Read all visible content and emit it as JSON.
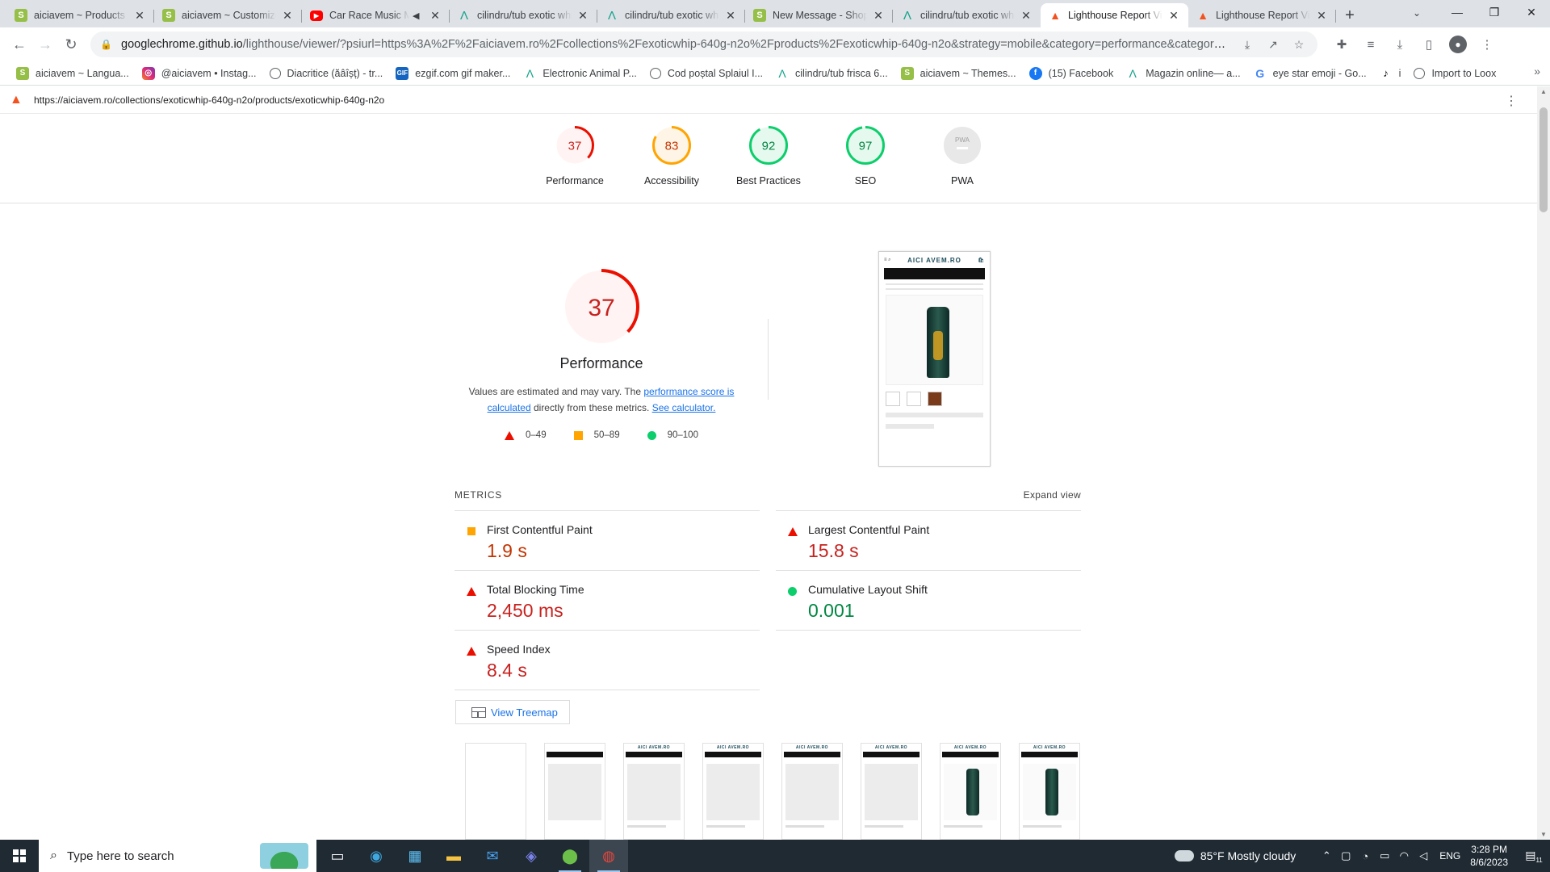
{
  "browser": {
    "tabs": [
      {
        "title": "aiciavem ~ Products ~ c",
        "icon": "shopify-icon",
        "active": false
      },
      {
        "title": "aiciavem ~ Customize C",
        "icon": "shopify-icon",
        "active": false
      },
      {
        "title": "Car Race Music Mi",
        "icon": "youtube-icon",
        "active": false,
        "audio": true
      },
      {
        "title": "cilindru/tub exotic whi",
        "icon": "aa-icon",
        "active": false
      },
      {
        "title": "cilindru/tub exotic whi",
        "icon": "aa-icon",
        "active": false
      },
      {
        "title": "New Message - Shopi",
        "icon": "shopify-icon",
        "active": false
      },
      {
        "title": "cilindru/tub exotic whi",
        "icon": "aa-icon",
        "active": false
      },
      {
        "title": "Lighthouse Report Vie",
        "icon": "lighthouse-icon",
        "active": true
      },
      {
        "title": "Lighthouse Report Vie",
        "icon": "lighthouse-icon",
        "active": false
      }
    ],
    "address": {
      "host": "googlechrome.github.io",
      "rest": "/lighthouse/viewer/?psiurl=https%3A%2F%2Faiciavem.ro%2Fcollections%2Fexoticwhip-640g-n2o%2Fproducts%2Fexoticwhip-640g-n2o&strategy=mobile&category=performance&category=accessibility&categor..."
    },
    "bookmarks": [
      {
        "label": "aiciavem ~ Langua...",
        "icon": "shop"
      },
      {
        "label": "@aiciavem • Instag...",
        "icon": "ig"
      },
      {
        "label": "Diacritice (ăâîșț) - tr...",
        "icon": "globe"
      },
      {
        "label": "ezgif.com gif maker...",
        "icon": "gif"
      },
      {
        "label": "Electronic Animal P...",
        "icon": "aa"
      },
      {
        "label": "Cod poștal Splaiul I...",
        "icon": "globe"
      },
      {
        "label": "cilindru/tub frisca 6...",
        "icon": "aa"
      },
      {
        "label": "aiciavem ~ Themes...",
        "icon": "shop"
      },
      {
        "label": "(15) Facebook",
        "icon": "fb"
      },
      {
        "label": "Magazin online— a...",
        "icon": "aa"
      },
      {
        "label": "eye star emoji - Go...",
        "icon": "g"
      },
      {
        "label": "i",
        "icon": "tt"
      },
      {
        "label": "Import to Loox",
        "icon": "globe"
      }
    ]
  },
  "lighthouse": {
    "report_url": "https://aiciavem.ro/collections/exoticwhip-640g-n2o/products/exoticwhip-640g-n2o",
    "gauges": [
      {
        "label": "Performance",
        "score": "37",
        "value": 37,
        "rating": "fail"
      },
      {
        "label": "Accessibility",
        "score": "83",
        "value": 83,
        "rating": "average"
      },
      {
        "label": "Best Practices",
        "score": "92",
        "value": 92,
        "rating": "pass"
      },
      {
        "label": "SEO",
        "score": "97",
        "value": 97,
        "rating": "pass"
      },
      {
        "label": "PWA",
        "score": "",
        "value": 0,
        "rating": "pwa",
        "badge": "PWA"
      }
    ],
    "perf": {
      "score": "37",
      "value": 37,
      "title": "Performance",
      "desc_before": "Values are estimated and may vary. The ",
      "desc_link1": "performance score is calculated",
      "desc_middle": " directly from these metrics. ",
      "desc_link2": "See calculator."
    },
    "legend": [
      {
        "shape": "triangle",
        "label": "0–49"
      },
      {
        "shape": "square",
        "label": "50–89"
      },
      {
        "shape": "circle",
        "label": "90–100"
      }
    ],
    "final_screenshot": {
      "brand": "AICI AVEM.RO"
    },
    "metrics_title": "METRICS",
    "expand_label": "Expand view",
    "metrics": [
      {
        "name": "First Contentful Paint",
        "value": "1.9 s",
        "rating": "average"
      },
      {
        "name": "Largest Contentful Paint",
        "value": "15.8 s",
        "rating": "fail"
      },
      {
        "name": "Total Blocking Time",
        "value": "2,450 ms",
        "rating": "fail"
      },
      {
        "name": "Cumulative Layout Shift",
        "value": "0.001",
        "rating": "pass"
      },
      {
        "name": "Speed Index",
        "value": "8.4 s",
        "rating": "fail"
      }
    ],
    "treemap_label": "View Treemap",
    "filmstrip_brand": "AICI AVEM.RO"
  },
  "colors": {
    "fail": "#eb0f00",
    "fail_text": "#c7221f",
    "average": "#ffa400",
    "average_text": "#c33300",
    "pass": "#0cce6b",
    "pass_text": "#018642",
    "fail_bg": "#fff4f3",
    "average_bg": "#fff5e6",
    "pass_bg": "#e6f9ef"
  },
  "taskbar": {
    "search_placeholder": "Type here to search",
    "weather": "85°F  Mostly cloudy",
    "lang": "ENG",
    "time": "3:28 PM",
    "date": "8/6/2023",
    "notif_count": "11"
  }
}
